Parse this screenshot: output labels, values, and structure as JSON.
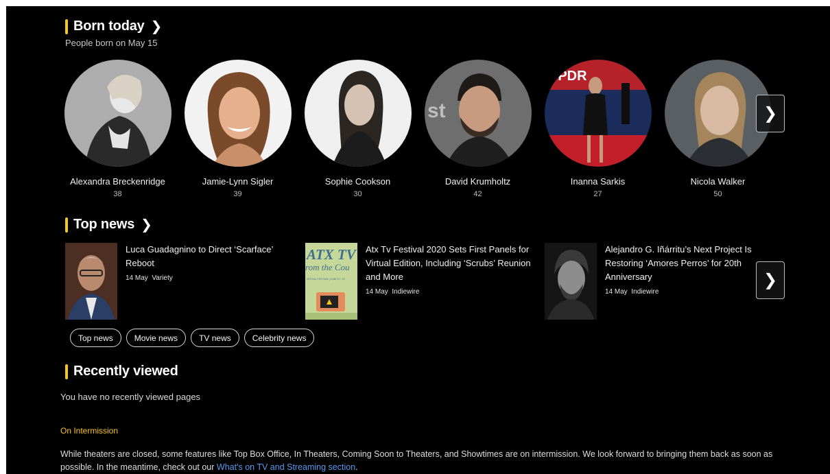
{
  "born_today": {
    "title": "Born today",
    "subtitle": "People born on May 15",
    "people": [
      {
        "name": "Alexandra Breckenridge",
        "age": "38"
      },
      {
        "name": "Jamie-Lynn Sigler",
        "age": "39"
      },
      {
        "name": "Sophie Cookson",
        "age": "30"
      },
      {
        "name": "David Krumholtz",
        "age": "42"
      },
      {
        "name": "Inanna Sarkis",
        "age": "27"
      },
      {
        "name": "Nicola Walker",
        "age": "50"
      }
    ]
  },
  "top_news": {
    "title": "Top news",
    "items": [
      {
        "headline": "Luca Guadagnino to Direct ‘Scarface’ Reboot",
        "date": "14 May",
        "source": "Variety"
      },
      {
        "headline": "Atx Tv Festival 2020 Sets First Panels for Virtual Edition, Including ‘Scrubs’ Reunion and More",
        "date": "14 May",
        "source": "Indiewire",
        "thumb_text_1": "ATX TV",
        "thumb_text_2": "rom the Cou",
        "thumb_text_3": "VIRTUAL FESTIVAL | JUNE 5-7, 20"
      },
      {
        "headline": "Alejandro G. Iñárritu’s Next Project Is Restoring ‘Amores Perros’ for 20th Anniversary",
        "date": "14 May",
        "source": "Indiewire"
      }
    ],
    "chips": [
      "Top news",
      "Movie news",
      "TV news",
      "Celebrity news"
    ]
  },
  "recently_viewed": {
    "title": "Recently viewed",
    "empty_text": "You have no recently viewed pages"
  },
  "intermission": {
    "heading": "On Intermission",
    "text": "While theaters are closed, some features like Top Box Office, In Theaters, Coming Soon to Theaters, and Showtimes are on intermission. We look forward to bringing them back as soon as possible. In the meantime, check out our ",
    "link": "What's on TV and Streaming section",
    "end": "."
  },
  "colors": {
    "accent": "#f5c518",
    "link": "#5799ef",
    "background": "#000000"
  },
  "icons": {
    "section_chevron": "chevron-right-icon",
    "carousel_next": "chevron-right-icon"
  }
}
